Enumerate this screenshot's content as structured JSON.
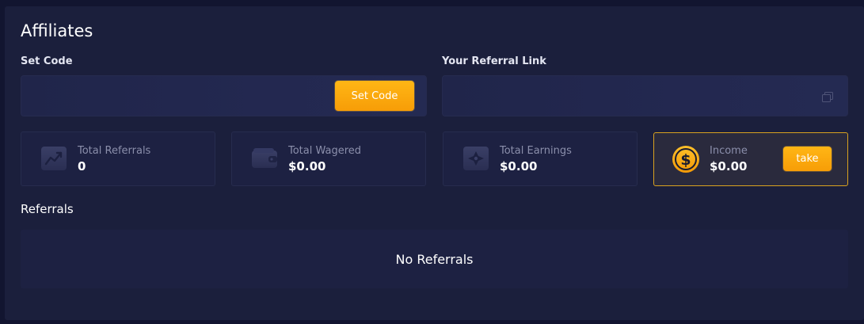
{
  "page": {
    "title": "Affiliates"
  },
  "set_code": {
    "label": "Set Code",
    "value": "",
    "placeholder": "",
    "button_label": "Set Code"
  },
  "referral_link": {
    "label": "Your Referral Link",
    "value": "",
    "copy_icon": "copy-icon"
  },
  "stats": [
    {
      "label": "Total Referrals",
      "value": "0",
      "icon": "chart-line-icon"
    },
    {
      "label": "Total Wagered",
      "value": "$0.00",
      "icon": "wallet-icon"
    },
    {
      "label": "Total Earnings",
      "value": "$0.00",
      "icon": "diamond-icon"
    }
  ],
  "income": {
    "label": "Income",
    "value": "$0.00",
    "icon": "dollar-coin-icon",
    "button_label": "take"
  },
  "referrals": {
    "title": "Referrals",
    "empty_text": "No Referrals"
  },
  "colors": {
    "background": "#121530",
    "panel": "#1b1f3c",
    "card": "#1d2142",
    "accent": "#f9a80b",
    "income_border": "#d9a21f",
    "muted_text": "#8b8fab"
  }
}
